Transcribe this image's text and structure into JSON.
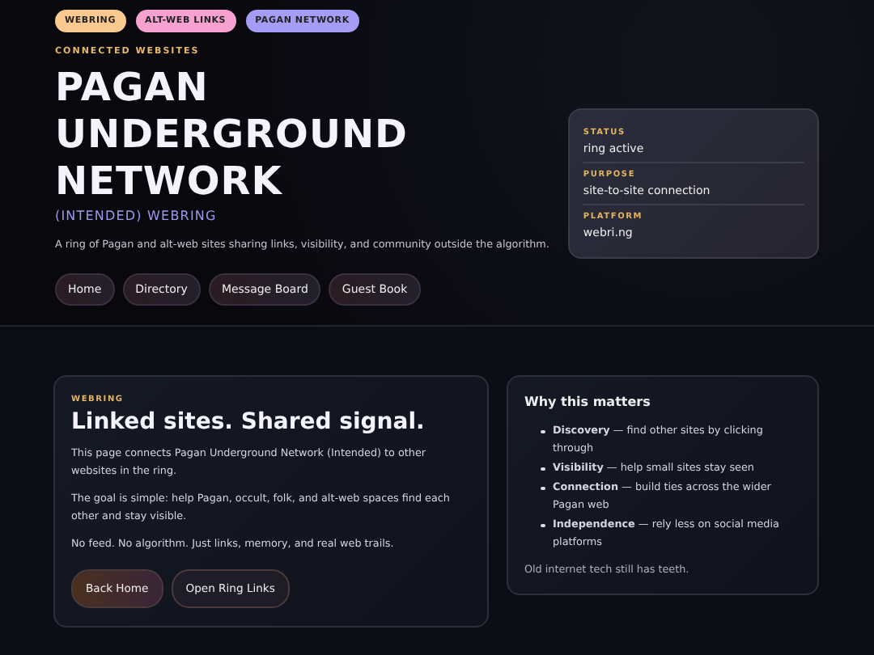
{
  "tags": [
    {
      "label": "WEBRING",
      "color": "#f9c98f"
    },
    {
      "label": "ALT-WEB LINKS",
      "color": "#f7a1d1"
    },
    {
      "label": "PAGAN NETWORK",
      "color": "#a59cf6"
    }
  ],
  "hero": {
    "eyebrow": "CONNECTED WEBSITES",
    "title_lines": [
      "PAGAN",
      "UNDERGROUND",
      "NETWORK"
    ],
    "subtitle": "(INTENDED) WEBRING",
    "description": "A ring of Pagan and alt-web sites sharing links, visibility, and community outside the algorithm."
  },
  "nav": [
    "Home",
    "Directory",
    "Message Board",
    "Guest Book"
  ],
  "info_card": [
    {
      "label": "STATUS",
      "value": "ring active"
    },
    {
      "label": "PURPOSE",
      "value": "site-to-site connection"
    },
    {
      "label": "PLATFORM",
      "value": "webri.ng"
    }
  ],
  "main_card": {
    "eyebrow": "WEBRING",
    "heading": "Linked sites. Shared signal.",
    "paragraphs": [
      "This page connects Pagan Underground Network (Intended) to other websites in the ring.",
      "The goal is simple: help Pagan, occult, folk, and alt-web spaces find each other and stay visible.",
      "No feed. No algorithm. Just links, memory, and real web trails."
    ],
    "buttons": [
      {
        "label": "Back Home",
        "kind": "primary"
      },
      {
        "label": "Open Ring Links",
        "kind": "secondary"
      }
    ]
  },
  "side_card": {
    "heading": "Why this matters",
    "items": [
      "**Discovery** — find other sites by clicking through",
      "**Visibility** — help small sites stay seen",
      "**Connection** — build ties across the wider Pagan web",
      "**Independence** — rely less on social media platforms"
    ],
    "footer": "Old internet tech still has teeth."
  }
}
